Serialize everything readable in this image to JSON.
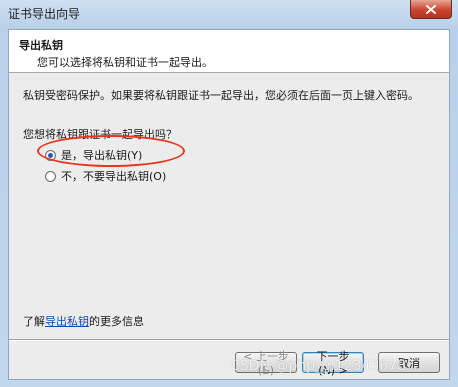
{
  "window": {
    "title": "证书导出向导"
  },
  "header": {
    "title": "导出私钥",
    "subtitle": "您可以选择将私钥和证书一起导出。"
  },
  "body": {
    "description": "私钥受密码保护。如果要将私钥跟证书一起导出，您必须在后面一页上键入密码。",
    "question": "您想将私钥跟证书一起导出吗？"
  },
  "options": [
    {
      "label": "是，导出私钥(Y)",
      "selected": true
    },
    {
      "label": "不，不要导出私钥(O)",
      "selected": false
    }
  ],
  "learn_more": {
    "prefix": "了解",
    "link": "导出私钥",
    "suffix": "的更多信息"
  },
  "buttons": {
    "back": "< 上一步(B)",
    "next": "下一步(N) >",
    "cancel": "取消"
  },
  "watermark": "CSDN @php_gl12345678",
  "colors": {
    "annotation": "#e9361e",
    "link": "#0a4db0",
    "radio_selected": "#2d5aa8"
  },
  "icons": [
    "close-icon"
  ]
}
